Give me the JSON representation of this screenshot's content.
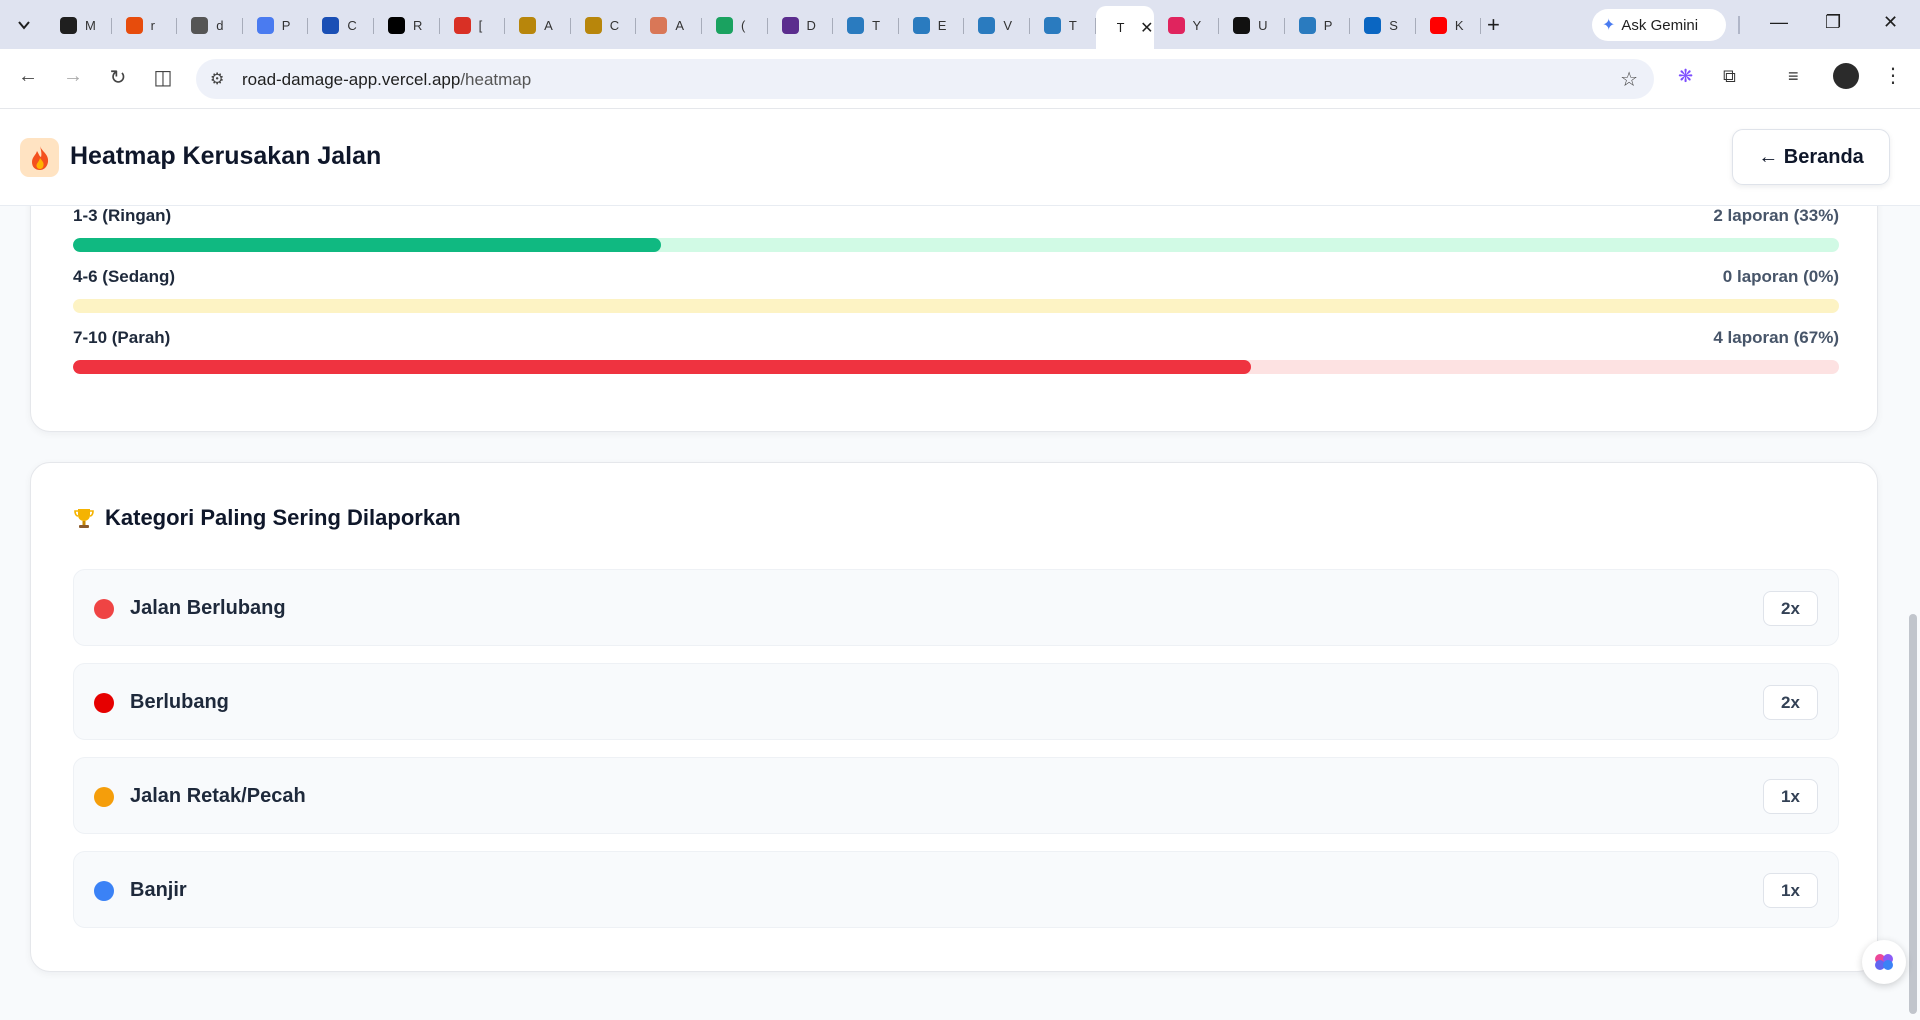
{
  "browser": {
    "tabs": [
      {
        "title": "M",
        "icon": "chatgpt-icon",
        "color": "#1f1f1f"
      },
      {
        "title": "r",
        "icon": "flame-icon",
        "color": "#e74c0c"
      },
      {
        "title": "d",
        "icon": "globe-icon",
        "color": "#555555"
      },
      {
        "title": "P",
        "icon": "gemini-icon",
        "color": "#4a7bf0"
      },
      {
        "title": "C",
        "icon": "cloud-icon",
        "color": "#1a4fb5"
      },
      {
        "title": "R",
        "icon": "k-icon",
        "color": "#000000"
      },
      {
        "title": "[",
        "icon": "gmail-icon",
        "color": "#d93025"
      },
      {
        "title": "A",
        "icon": "asterisk-icon",
        "color": "#b8860b"
      },
      {
        "title": "C",
        "icon": "asterisk-icon",
        "color": "#b8860b"
      },
      {
        "title": "A",
        "icon": "claude-icon",
        "color": "#d97757"
      },
      {
        "title": "(",
        "icon": "badge-16-icon",
        "color": "#1aa260"
      },
      {
        "title": "D",
        "icon": "hexagon-icon",
        "color": "#5b2d8e"
      },
      {
        "title": "T",
        "icon": "emblem-icon",
        "color": "#2a7bbf"
      },
      {
        "title": "E",
        "icon": "emblem-icon",
        "color": "#2a7bbf"
      },
      {
        "title": "V",
        "icon": "emblem-icon",
        "color": "#2a7bbf"
      },
      {
        "title": "T",
        "icon": "emblem-icon",
        "color": "#2a7bbf"
      }
    ],
    "active_tab": {
      "title": "T"
    },
    "tabs_after": [
      {
        "title": "Y",
        "icon": "play-icon",
        "color": "#e0245e"
      },
      {
        "title": "U",
        "icon": "bolt-icon",
        "color": "#111111"
      },
      {
        "title": "P",
        "icon": "emblem-icon",
        "color": "#2a7bbf"
      },
      {
        "title": "S",
        "icon": "linkedin-icon",
        "color": "#0a66c2"
      },
      {
        "title": "K",
        "icon": "youtube-icon",
        "color": "#ff0000"
      }
    ],
    "ask_gemini": "Ask Gemini",
    "url_domain": "road-damage-app.vercel.app",
    "url_path": "/heatmap"
  },
  "header": {
    "title": "Heatmap Kerusakan Jalan",
    "home_button": "← Beranda",
    "logo_icon": "fire-icon"
  },
  "severity": {
    "rows": [
      {
        "label": "1-3 (Ringan)",
        "count_text": "2 laporan (33%)",
        "percent": 33.3,
        "fill": "#10b981",
        "track": "#d1fae5"
      },
      {
        "label": "4-6 (Sedang)",
        "count_text": "0 laporan (0%)",
        "percent": 0,
        "fill": "#f59e0b",
        "track": "#fdf3c4"
      },
      {
        "label": "7-10 (Parah)",
        "count_text": "4 laporan (67%)",
        "percent": 66.7,
        "fill": "#ef3340",
        "track": "#fde2e2"
      }
    ]
  },
  "categories": {
    "title": "Kategori Paling Sering Dilaporkan",
    "title_icon": "trophy-icon",
    "items": [
      {
        "name": "Jalan Berlubang",
        "count": "2x",
        "color": "#ef4444"
      },
      {
        "name": "Berlubang",
        "count": "2x",
        "color": "#e60000"
      },
      {
        "name": "Jalan Retak/Pecah",
        "count": "1x",
        "color": "#f59e0b"
      },
      {
        "name": "Banjir",
        "count": "1x",
        "color": "#3b82f6"
      }
    ]
  }
}
